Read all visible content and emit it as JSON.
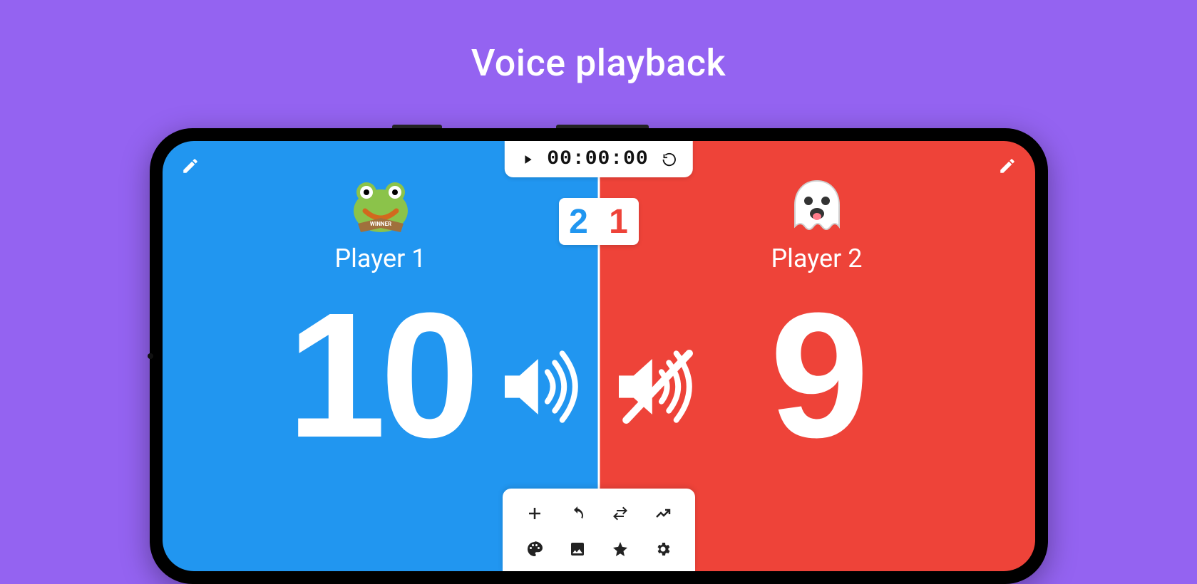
{
  "page_title": "Voice playback",
  "timer": {
    "value": "00:00:00"
  },
  "set_score": {
    "left": "2",
    "right": "1"
  },
  "players": {
    "left": {
      "name": "Player 1",
      "score": "10",
      "color": "#2196f0",
      "avatar": "frog",
      "voice_on": true
    },
    "right": {
      "name": "Player 2",
      "score": "9",
      "color": "#ee4339",
      "avatar": "ghost",
      "voice_on": false
    }
  },
  "toolbar": {
    "add": "add",
    "undo": "undo",
    "swap": "swap",
    "trend": "trend",
    "palette": "palette",
    "image": "image",
    "star": "star",
    "settings": "settings"
  }
}
